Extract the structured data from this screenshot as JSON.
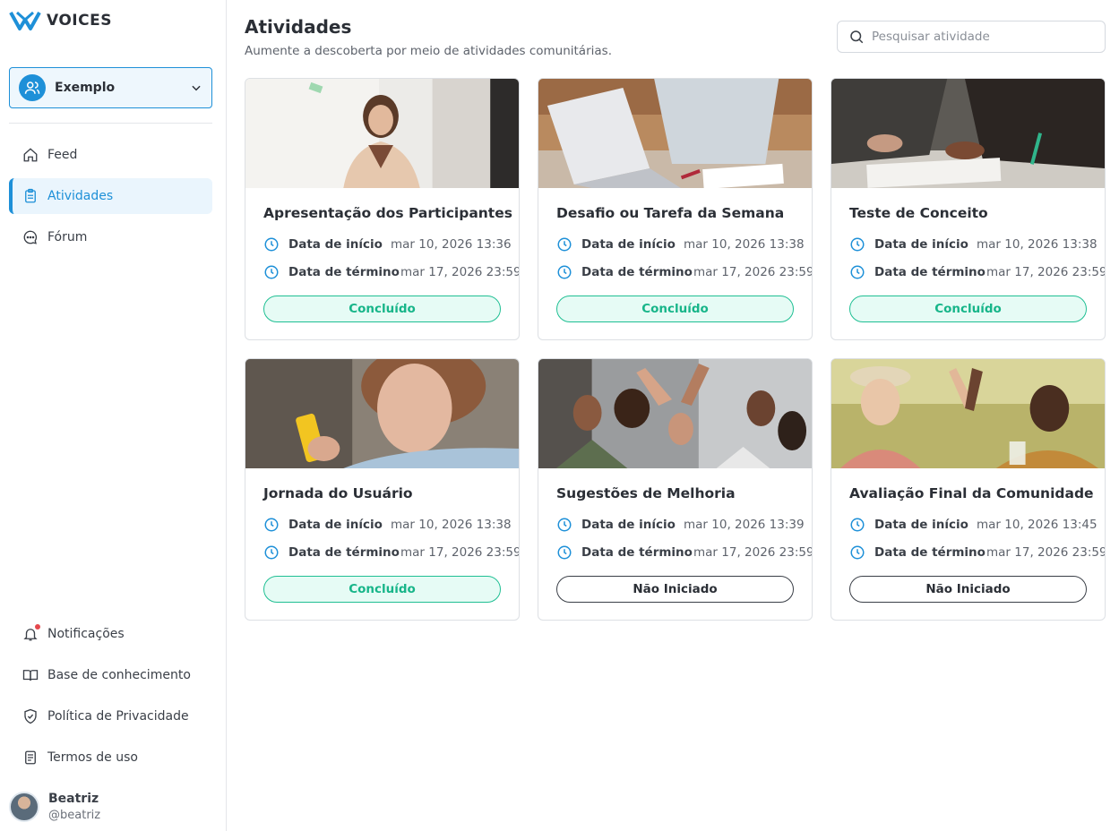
{
  "brand": {
    "name": "VOICES",
    "accent": "#1e90d8"
  },
  "workspace": {
    "name": "Exemplo",
    "icon": "users-icon"
  },
  "nav": {
    "items": [
      {
        "label": "Feed",
        "icon": "home-icon",
        "active": false
      },
      {
        "label": "Atividades",
        "icon": "clipboard-icon",
        "active": true
      },
      {
        "label": "Fórum",
        "icon": "chat-bubble-icon",
        "active": false
      }
    ]
  },
  "bottom_nav": {
    "items": [
      {
        "label": "Notificações",
        "icon": "bell-icon"
      },
      {
        "label": "Base de conhecimento",
        "icon": "book-icon"
      },
      {
        "label": "Política de Privacidade",
        "icon": "shield-check-icon"
      },
      {
        "label": "Termos de uso",
        "icon": "document-icon"
      }
    ]
  },
  "user": {
    "name": "Beatriz",
    "handle": "@beatriz"
  },
  "page": {
    "title": "Atividades",
    "subtitle": "Aumente a descoberta por meio de atividades comunitárias.",
    "search_placeholder": "Pesquisar atividade"
  },
  "labels": {
    "start": "Data de início",
    "end": "Data de término"
  },
  "activities": [
    {
      "title": "Apresentação dos Participantes",
      "start": "mar 10, 2026 13:36",
      "end": "mar 17, 2026 23:59",
      "status": "Concluído",
      "status_type": "done"
    },
    {
      "title": "Desafio ou Tarefa da Semana",
      "start": "mar 10, 2026 13:38",
      "end": "mar 17, 2026 23:59",
      "status": "Concluído",
      "status_type": "done"
    },
    {
      "title": "Teste de Conceito",
      "start": "mar 10, 2026 13:38",
      "end": "mar 17, 2026 23:59",
      "status": "Concluído",
      "status_type": "done"
    },
    {
      "title": "Jornada do Usuário",
      "start": "mar 10, 2026 13:38",
      "end": "mar 17, 2026 23:59",
      "status": "Concluído",
      "status_type": "done"
    },
    {
      "title": "Sugestões de Melhoria",
      "start": "mar 10, 2026 13:39",
      "end": "mar 17, 2026 23:59",
      "status": "Não Iniciado",
      "status_type": "todo"
    },
    {
      "title": "Avaliação Final da Comunidade",
      "start": "mar 10, 2026 13:45",
      "end": "mar 17, 2026 23:59",
      "status": "Não Iniciado",
      "status_type": "todo"
    }
  ],
  "colors": {
    "done": "#17b589",
    "done_bg": "#e6fbf5",
    "notification_dot": "#e5484d"
  }
}
